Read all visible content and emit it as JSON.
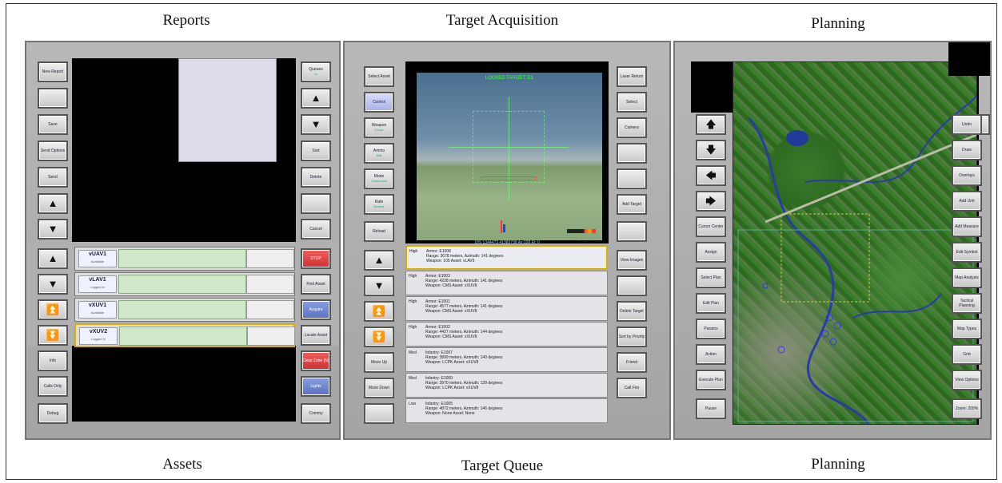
{
  "captions": {
    "top": [
      "Reports",
      "Target Acquisition",
      "Planning"
    ],
    "bottom": [
      "Assets",
      "Target Queue",
      "Planning"
    ]
  },
  "reports": {
    "left_buttons": [
      "New Report",
      "",
      "Save",
      "Send Options",
      "Send"
    ],
    "right_buttons": [
      "Queues",
      "",
      "",
      "Sort",
      "Delete",
      "",
      "Cancel"
    ],
    "right_buttons_sub": [
      "In"
    ]
  },
  "assets": {
    "left_buttons": [
      "Info",
      "Calls Only",
      "Debug"
    ],
    "right_buttons": [
      "STOP",
      "Find Asset",
      "Acquire",
      "Locate Asset",
      "Clear Zone (N)",
      "Lights",
      "Commy"
    ],
    "rows": [
      {
        "name": "vUAV1",
        "sub": "Available"
      },
      {
        "name": "vLAV1",
        "sub": "Logged In"
      },
      {
        "name": "vXUV1",
        "sub": "Available"
      },
      {
        "name": "vXUV2",
        "sub": "Logged In"
      }
    ]
  },
  "acquisition": {
    "left_buttons": [
      {
        "label": "Select Asset",
        "sub": ""
      },
      {
        "label": "Control",
        "sub": ""
      },
      {
        "label": "Weapon",
        "sub": "Cross"
      },
      {
        "label": "Ammo",
        "sub": "Ball"
      },
      {
        "label": "Mode",
        "sub": "Continuous"
      },
      {
        "label": "Rate",
        "sub": "Normal"
      },
      {
        "label": "Reload",
        "sub": ""
      }
    ],
    "right_buttons": [
      "Laser Return",
      "Select",
      "Camera",
      "",
      "",
      "Add Target",
      ""
    ],
    "hud_top": "LOCKED TARGET: E1",
    "hud_bottom": "18S 1344473 41383738    Az:228  El: 0"
  },
  "queue": {
    "left_buttons": [
      "",
      "",
      "",
      "",
      "Move Up",
      "Move Down",
      ""
    ],
    "right_buttons": [
      "View Images",
      "",
      "Delete Target",
      "Sort by Priority",
      "Friend",
      "Call Fire"
    ],
    "rows": [
      {
        "priority": "High",
        "line1": "Armor: E1008",
        "line2": "Range: 3678 meters, Azimuth: 141 degrees",
        "line3": "Weapon: 105 Asset: vLAV9"
      },
      {
        "priority": "High",
        "line1": "Armor: E1003",
        "line2": "Range: 4228 meters, Azimuth: 141 degrees",
        "line3": "Weapon: CMS Asset: vXUV8"
      },
      {
        "priority": "High",
        "line1": "Armor: E1001",
        "line2": "Range: 4577 meters, Azimuth: 141 degrees",
        "line3": "Weapon: CMS Asset: vXUV8"
      },
      {
        "priority": "High",
        "line1": "Armor: E1002",
        "line2": "Range: 4427 meters, Azimuth: 144 degrees",
        "line3": "Weapon: CMS Asset: vXUV8"
      },
      {
        "priority": "Med",
        "line1": "Infantry: E1007",
        "line2": "Range: 3899 meters, Azimuth: 140 degrees",
        "line3": "Weapon: LCPK Asset: vXUV8"
      },
      {
        "priority": "Med",
        "line1": "Infantry: E1009",
        "line2": "Range: 3970 meters, Azimuth: 139 degrees",
        "line3": "Weapon: LCPK Asset: vXUV8"
      },
      {
        "priority": "Low",
        "line1": "Infantry: E1005",
        "line2": "Range: 4872 meters, Azimuth: 146 degrees",
        "line3": "Weapon: None Asset: None"
      }
    ]
  },
  "planning": {
    "left_buttons": [
      "Cursor Center",
      "Assign",
      "Select Plan",
      "Edit Plan",
      "Params",
      "Action",
      "Execute Plan",
      "Pause"
    ],
    "right_buttons": [
      "Undo",
      "Draw",
      "Overlays",
      "Add Unit",
      "Add Measure",
      "Edit Symbol",
      "Map Analysis",
      "Tactical Planning",
      "Map Types",
      "Grid",
      "View Options",
      "Zoom: 200%"
    ]
  }
}
